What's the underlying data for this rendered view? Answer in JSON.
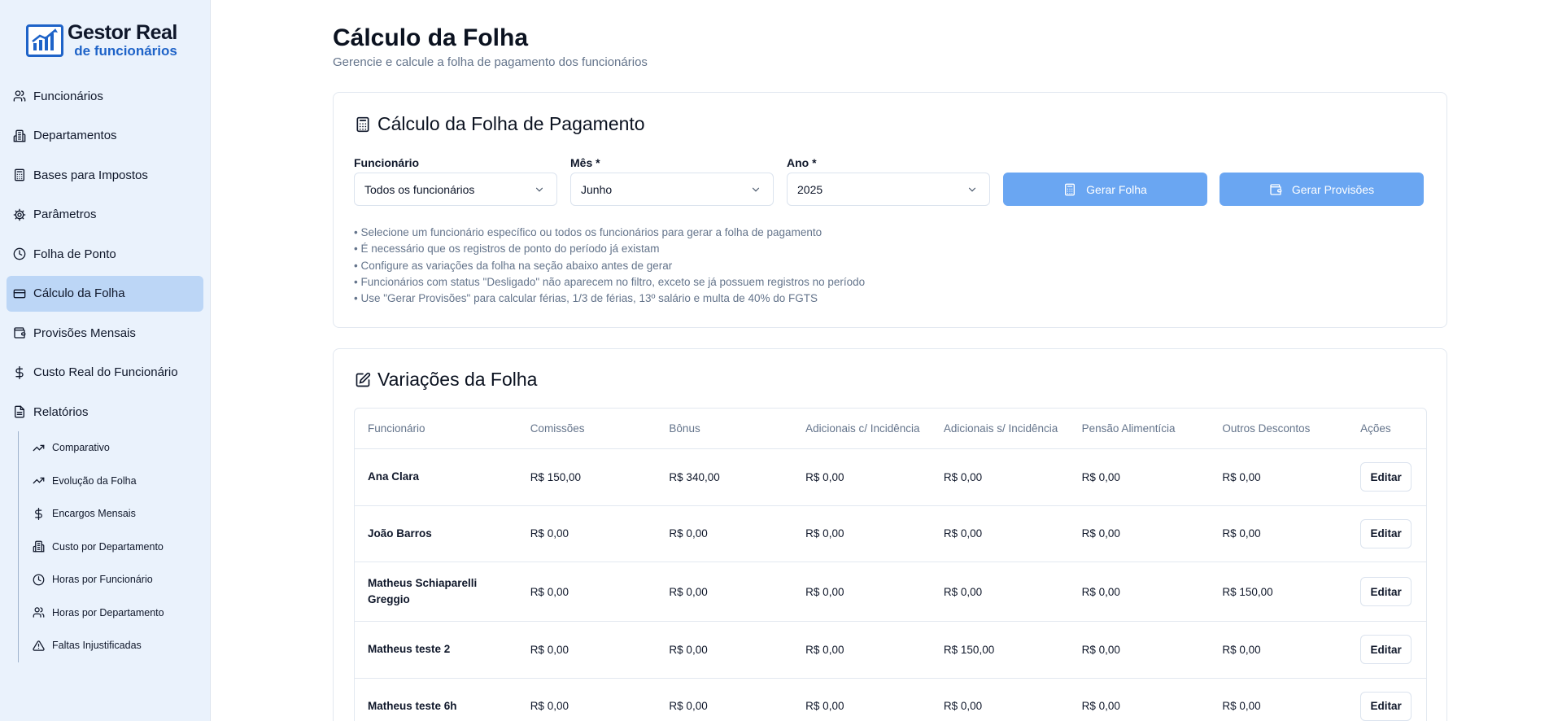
{
  "app": {
    "logo_line1": "Gestor Real",
    "logo_line2": "de funcionários"
  },
  "sidebar": {
    "items": [
      {
        "label": "Funcionários",
        "icon": "users-icon"
      },
      {
        "label": "Departamentos",
        "icon": "building-icon"
      },
      {
        "label": "Bases para Impostos",
        "icon": "calculator-icon"
      },
      {
        "label": "Parâmetros",
        "icon": "gear-icon"
      },
      {
        "label": "Folha de Ponto",
        "icon": "clock-icon"
      },
      {
        "label": "Cálculo da Folha",
        "icon": "credit-card-icon",
        "active": true
      },
      {
        "label": "Provisões Mensais",
        "icon": "wallet-icon"
      },
      {
        "label": "Custo Real do Funcionário",
        "icon": "dollar-icon"
      },
      {
        "label": "Relatórios",
        "icon": "file-icon"
      }
    ],
    "sub_items": [
      {
        "label": "Comparativo",
        "icon": "trending-up-icon"
      },
      {
        "label": "Evolução da Folha",
        "icon": "trending-up-icon"
      },
      {
        "label": "Encargos Mensais",
        "icon": "dollar-icon"
      },
      {
        "label": "Custo por Departamento",
        "icon": "building-icon"
      },
      {
        "label": "Horas por Funcionário",
        "icon": "clock-icon"
      },
      {
        "label": "Horas por Departamento",
        "icon": "users-icon"
      },
      {
        "label": "Faltas Injustificadas",
        "icon": "alert-triangle-icon"
      }
    ]
  },
  "header": {
    "title": "Cálculo da Folha",
    "subtitle": "Gerencie e calcule a folha de pagamento dos funcionários"
  },
  "payroll_card": {
    "title": "Cálculo da Folha de Pagamento",
    "employee_label": "Funcionário",
    "employee_value": "Todos os funcionários",
    "month_label": "Mês *",
    "month_value": "Junho",
    "year_label": "Ano *",
    "year_value": "2025",
    "generate_button": "Gerar Folha",
    "provisions_button": "Gerar Provisões",
    "notes": [
      "• Selecione um funcionário específico ou todos os funcionários para gerar a folha de pagamento",
      "• É necessário que os registros de ponto do período já existam",
      "• Configure as variações da folha na seção abaixo antes de gerar",
      "• Funcionários com status \"Desligado\" não aparecem no filtro, exceto se já possuem registros no período",
      "• Use \"Gerar Provisões\" para calcular férias, 1/3 de férias, 13º salário e multa de 40% do FGTS"
    ]
  },
  "variations_card": {
    "title": "Variações da Folha",
    "columns": [
      "Funcionário",
      "Comissões",
      "Bônus",
      "Adicionais c/ Incidência",
      "Adicionais s/ Incidência",
      "Pensão Alimentícia",
      "Outros Descontos",
      "Ações"
    ],
    "rows": [
      {
        "name": "Ana Clara",
        "comissoes": "R$ 150,00",
        "bonus": "R$ 340,00",
        "adic_c": "R$ 0,00",
        "adic_s": "R$ 0,00",
        "pensao": "R$ 0,00",
        "outros": "R$ 0,00",
        "action": "Editar"
      },
      {
        "name": "João Barros",
        "comissoes": "R$ 0,00",
        "bonus": "R$ 0,00",
        "adic_c": "R$ 0,00",
        "adic_s": "R$ 0,00",
        "pensao": "R$ 0,00",
        "outros": "R$ 0,00",
        "action": "Editar"
      },
      {
        "name": "Matheus Schiaparelli Greggio",
        "comissoes": "R$ 0,00",
        "bonus": "R$ 0,00",
        "adic_c": "R$ 0,00",
        "adic_s": "R$ 0,00",
        "pensao": "R$ 0,00",
        "outros": "R$ 150,00",
        "action": "Editar"
      },
      {
        "name": "Matheus teste 2",
        "comissoes": "R$ 0,00",
        "bonus": "R$ 0,00",
        "adic_c": "R$ 0,00",
        "adic_s": "R$ 150,00",
        "pensao": "R$ 0,00",
        "outros": "R$ 0,00",
        "action": "Editar"
      },
      {
        "name": "Matheus teste 6h",
        "comissoes": "R$ 0,00",
        "bonus": "R$ 0,00",
        "adic_c": "R$ 0,00",
        "adic_s": "R$ 0,00",
        "pensao": "R$ 0,00",
        "outros": "R$ 0,00",
        "action": "Editar"
      }
    ]
  },
  "colors": {
    "sidebar_bg": "#eaf2fc",
    "active_item": "#bcd6f6",
    "primary_button": "#6aa6f2",
    "brand_blue": "#1e63c8"
  }
}
